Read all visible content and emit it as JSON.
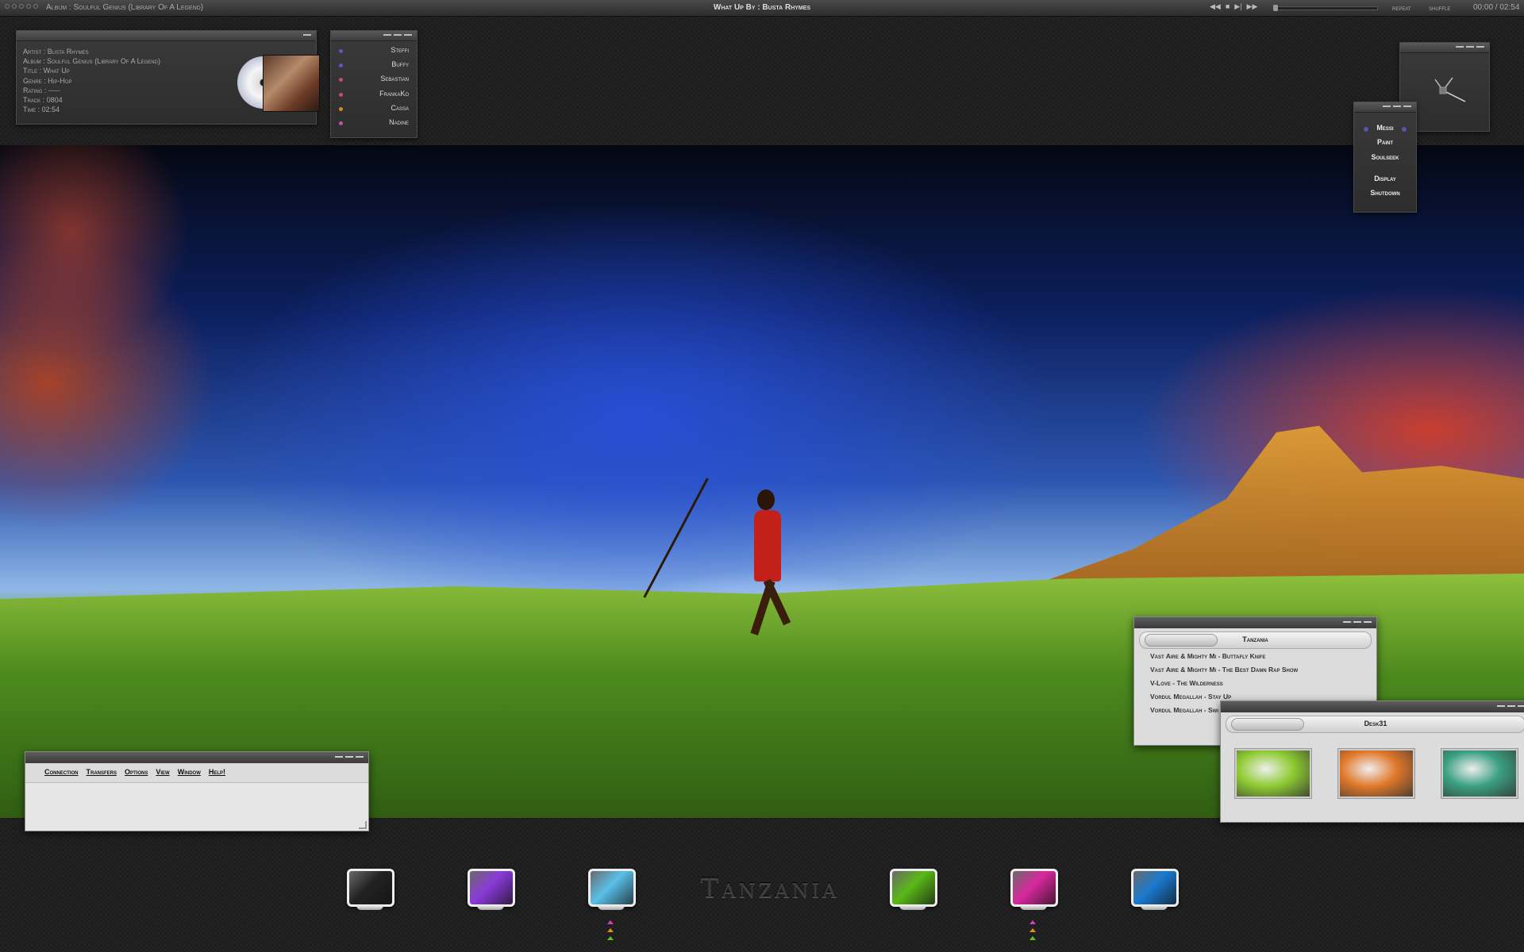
{
  "player": {
    "album_line": "Album : Soulful Genius (Library Of A Legend)",
    "now_playing": "What Up By : Busta Rhymes",
    "repeat_label": "repeat",
    "shuffle_label": "shuffle",
    "time": "00:00 / 02:54",
    "progress_fraction": 0.0,
    "controls": {
      "prev": "◀◀",
      "stop": "■",
      "play": "▶|",
      "next": "▶▶"
    }
  },
  "track_info": {
    "artist": "Artist : Busta Rhymes",
    "album": "Album : Soulful Genius (Library Of A Legend)",
    "title": "Title : What Up",
    "genre": "Genre : Hip-Hop",
    "rating": "Rating : -----",
    "track": "Track : 0804",
    "time": "Time : 02:54"
  },
  "contacts": [
    {
      "name": "Steffi",
      "color": "#5a58c8"
    },
    {
      "name": "Buffy",
      "color": "#5a58c8"
    },
    {
      "name": "Sebastian",
      "color": "#c84a6a"
    },
    {
      "name": "FrankaKo",
      "color": "#c84a6a"
    },
    {
      "name": "Cassa",
      "color": "#d08a30"
    },
    {
      "name": "Nadine",
      "color": "#b85a9a"
    }
  ],
  "launcher": [
    "Messi",
    "Paint",
    "Soulseek",
    "Display",
    "Shutdown"
  ],
  "playlist": {
    "title": "Tanzania",
    "items": [
      "Vast Aire & Mighty Mi - Buttafly Knife",
      "Vast Aire & Mighty Mi - The Best Damn Rap Show",
      "V-Love - The Wilderness",
      "Vordul Megallah - Stay Up",
      "Vordul Megallah - Swi"
    ]
  },
  "desk": {
    "title": "Desk31",
    "thumbnails": [
      {
        "name": "green-leaf",
        "color": "#8ecb32"
      },
      {
        "name": "orange-leaf",
        "color": "#e0782a"
      },
      {
        "name": "teal-leaf",
        "color": "#3aa080"
      }
    ]
  },
  "soulseek": {
    "menu": [
      "Connection",
      "Transfers",
      "Options",
      "View",
      "Window",
      "Help!"
    ]
  },
  "dock": {
    "title": "Tanzania",
    "icons": [
      {
        "name": "black-monitor",
        "color": "#222222"
      },
      {
        "name": "purple-monitor",
        "color": "#8a3ad8"
      },
      {
        "name": "aqua-monitor",
        "color": "#5ac0e8"
      },
      {
        "name": "green-monitor",
        "color": "#5ab818"
      },
      {
        "name": "magenta-monitor",
        "color": "#d8289c"
      },
      {
        "name": "blue-monitor",
        "color": "#1a7ad0"
      }
    ]
  }
}
